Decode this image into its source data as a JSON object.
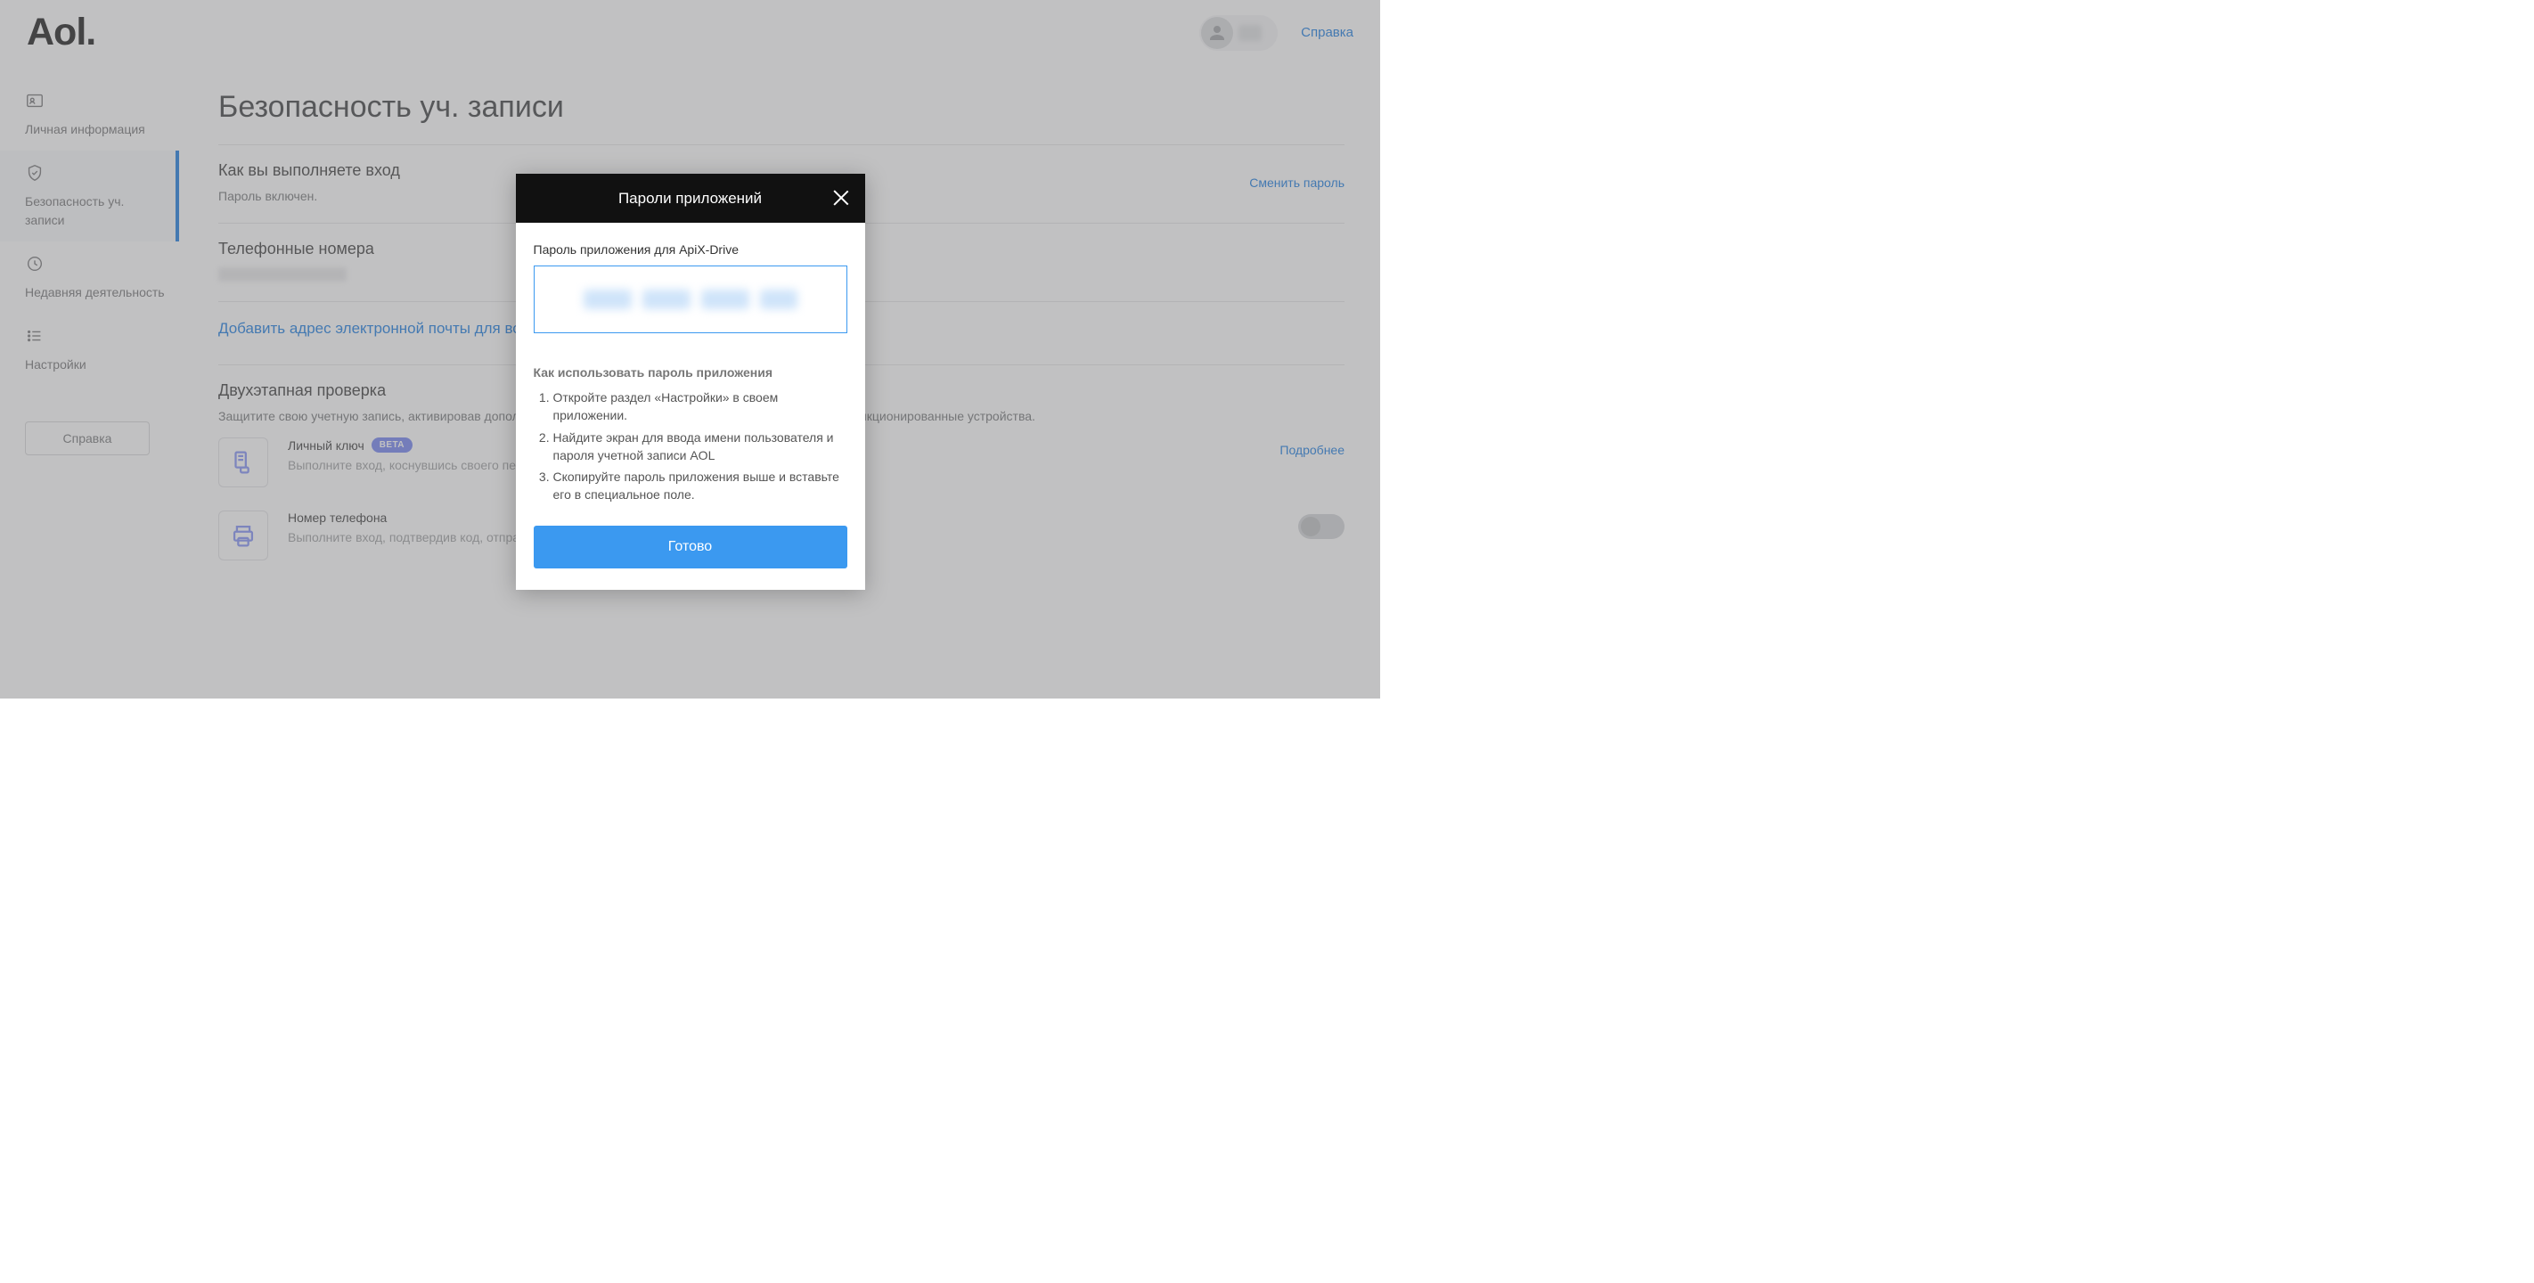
{
  "header": {
    "logo": "Aol.",
    "help": "Справка"
  },
  "sidebar": {
    "items": [
      {
        "label": "Личная информация"
      },
      {
        "label": "Безопасность уч. записи"
      },
      {
        "label": "Недавняя деятельность"
      },
      {
        "label": "Настройки"
      }
    ],
    "help_btn": "Справка"
  },
  "main": {
    "title": "Безопасность уч. записи",
    "signin": {
      "title": "Как вы выполняете вход",
      "status": "Пароль включен.",
      "action": "Сменить пароль"
    },
    "phones": {
      "title": "Телефонные номера"
    },
    "email_recovery": "Добавить адрес электронной почты для восстановления",
    "two_step": {
      "title": "Двухэтапная проверка",
      "desc": "Защитите свою учетную запись, активировав дополнительный этап верификации и заблокировав любые несанкционированные устройства.",
      "rows": [
        {
          "title": "Личный ключ",
          "badge": "BETA",
          "desc": "Выполните вход, коснувшись своего персонального устройства.",
          "action": "Подробнее"
        },
        {
          "title": "Номер телефона",
          "desc": "Выполните вход, подтвердив код, отправленный вам в SMS."
        }
      ]
    }
  },
  "modal": {
    "title": "Пароли приложений",
    "label": "Пароль приложения для ApiX-Drive",
    "howto_heading": "Как использовать пароль приложения",
    "steps": [
      "Откройте раздел «Настройки» в своем приложении.",
      "Найдите экран для ввода имени пользователя и пароля учетной записи AOL",
      "Скопируйте пароль приложения выше и вставьте его в специальное поле."
    ],
    "done": "Готово"
  }
}
